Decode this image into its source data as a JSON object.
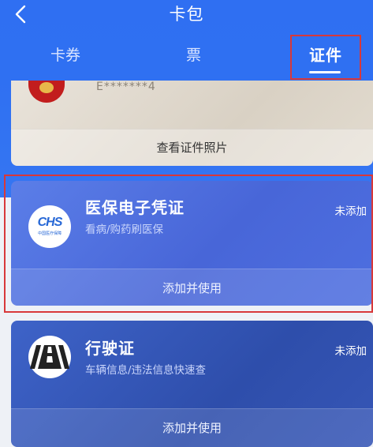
{
  "header": {
    "title": "卡包",
    "tabs": [
      {
        "label": "卡券"
      },
      {
        "label": "票"
      },
      {
        "label": "证件"
      }
    ]
  },
  "id_card": {
    "number": "E*******4",
    "view_label": "查看证件照片"
  },
  "medical_card": {
    "name": "医保电子凭证",
    "subtitle": "看病/购药刷医保",
    "status": "未添加",
    "action": "添加并使用",
    "logo_text": "CHS",
    "logo_subtext": "中国医疗保障"
  },
  "vehicle_card": {
    "name": "行驶证",
    "subtitle": "车辆信息/违法信息快速查",
    "status": "未添加",
    "action": "添加并使用"
  },
  "colors": {
    "header_bg": "#2f6ff2",
    "highlight_border": "#d8383a",
    "medical_card_bg": "#4866d8",
    "vehicle_card_bg": "#2e4eab"
  }
}
